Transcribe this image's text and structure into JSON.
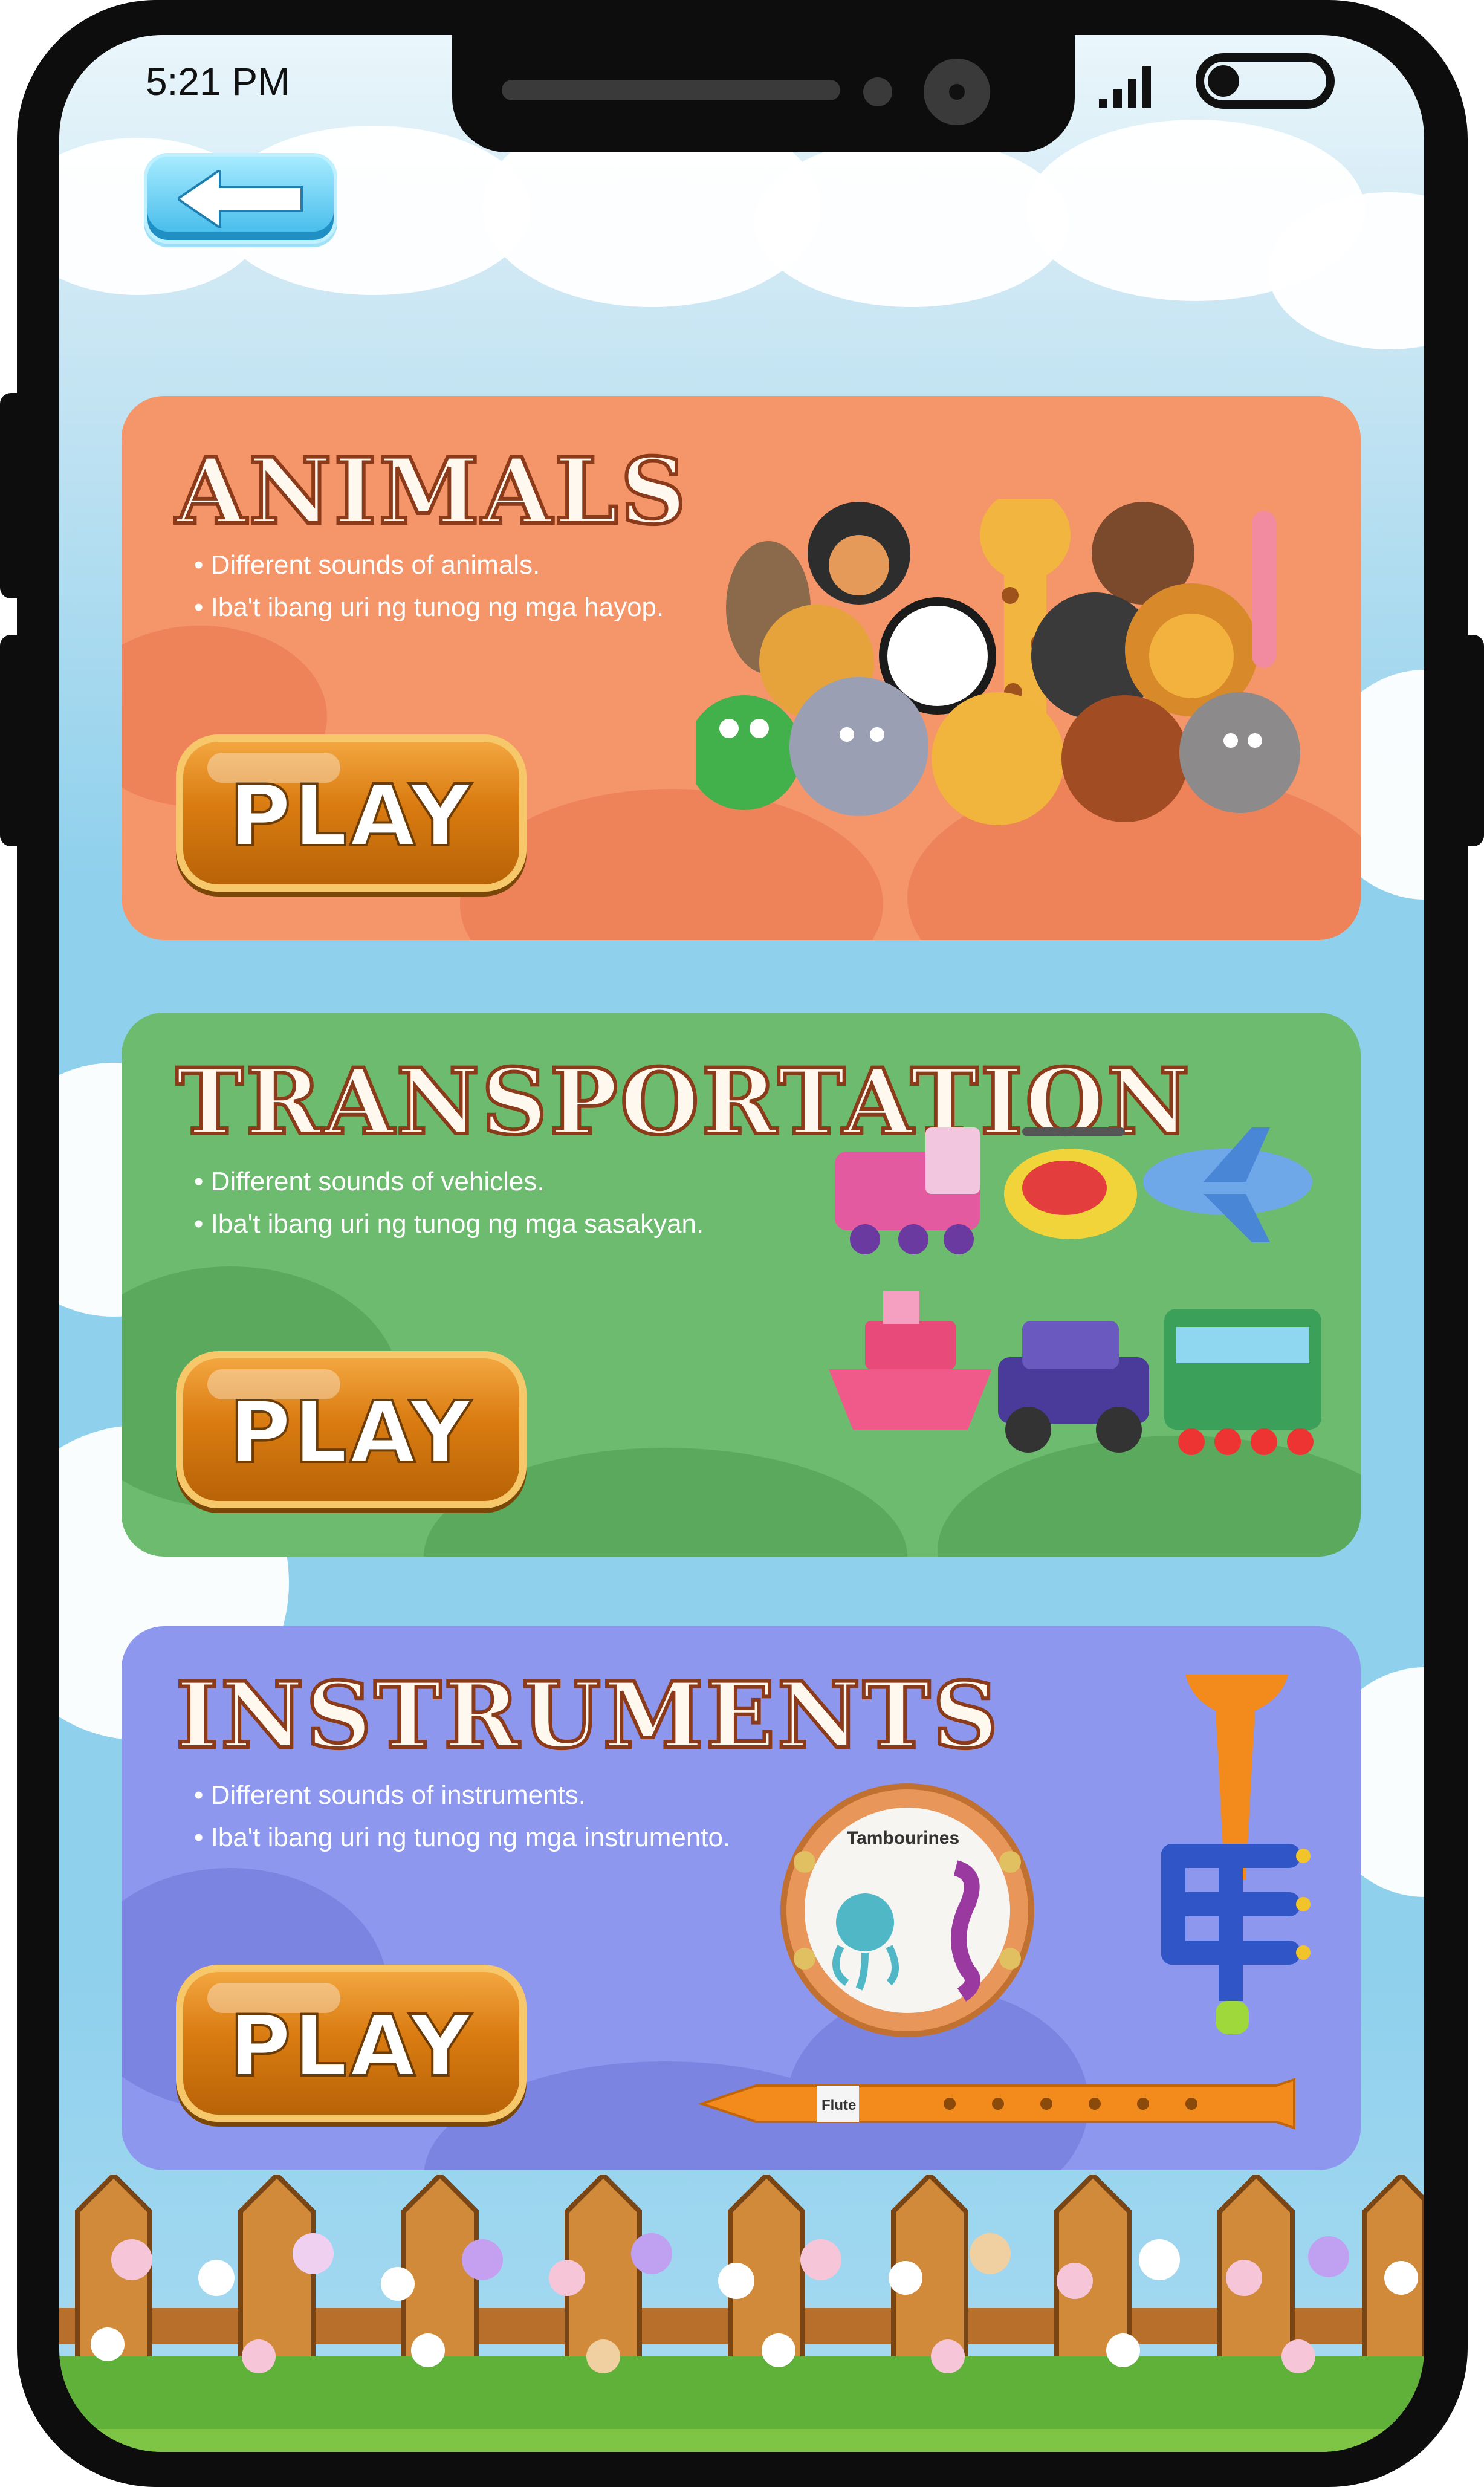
{
  "status_bar": {
    "time": "5:21 PM"
  },
  "nav": {
    "back_icon": "arrow-left-icon"
  },
  "categories": [
    {
      "title": "ANIMALS",
      "bullets": [
        "Different sounds of animals.",
        "Iba't ibang uri ng tunog ng mga hayop."
      ],
      "play_label": "PLAY",
      "color": "#f4956a"
    },
    {
      "title": "TRANSPORTATION",
      "bullets": [
        "Different sounds of vehicles.",
        "Iba't ibang uri ng tunog ng mga sasakyan."
      ],
      "play_label": "PLAY",
      "color": "#6cbb6e"
    },
    {
      "title": "INSTRUMENTS",
      "bullets": [
        "Different sounds of instruments.",
        "Iba't ibang uri ng tunog ng mga instrumento."
      ],
      "play_label": "PLAY",
      "color": "#8e97ee"
    }
  ],
  "instrument_labels": {
    "tambourine": "Tambourines",
    "flute": "Flute"
  }
}
